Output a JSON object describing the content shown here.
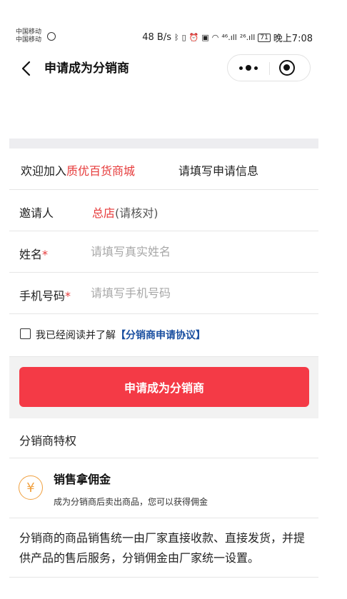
{
  "status_bar": {
    "carrier_1": "中国移动",
    "carrier_2": "中国移动",
    "speed": "48 B/s",
    "signal_1": "⁴⁶.ıll",
    "signal_2": "²⁶.ıll",
    "battery": "71",
    "time": "晚上7:08"
  },
  "nav": {
    "title": "申请成为分销商"
  },
  "welcome": {
    "prefix": "欢迎加入",
    "shop_name": "质优百货商城",
    "hint": "请填写申请信息"
  },
  "form": {
    "inviter_label": "邀请人",
    "inviter_name": "总店",
    "inviter_note": "(请核对)",
    "name_label": "姓名",
    "name_placeholder": "请填写真实姓名",
    "phone_label": "手机号码",
    "phone_placeholder": "请填写手机号码",
    "required_mark": "*"
  },
  "agreement": {
    "text": "我已经阅读并了解",
    "link": "【分销商申请协议】"
  },
  "submit_label": "申请成为分销商",
  "privileges": {
    "title": "分销商特权",
    "items": [
      {
        "icon": "yen-icon",
        "glyph": "¥",
        "name": "销售拿佣金",
        "desc": "成为分销商后卖出商品，您可以获得佣金"
      }
    ]
  },
  "description": "分销商的商品销售统一由厂家直接收款、直接发货，并提供产品的售后服务，分销佣金由厂家统一设置。",
  "colors": {
    "accent": "#f43a46",
    "shop_red": "#e63a3a",
    "link_blue": "#1a4fa0",
    "icon_orange": "#f0a040"
  }
}
